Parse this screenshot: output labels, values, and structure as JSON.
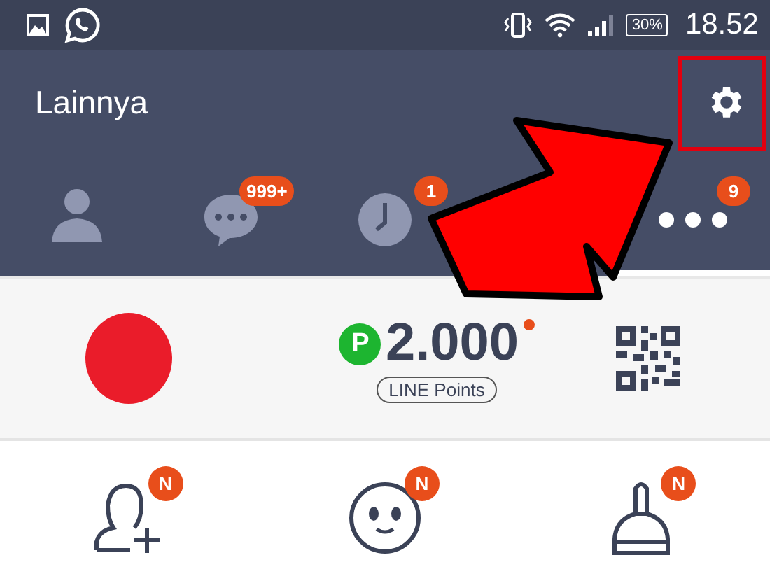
{
  "status_bar": {
    "battery": "30%",
    "time": "18.52"
  },
  "header": {
    "title": "Lainnya"
  },
  "tabs": [
    {
      "kind": "friends",
      "selected": false
    },
    {
      "kind": "chats",
      "badge": "999+",
      "selected": false
    },
    {
      "kind": "timeline",
      "badge": "1",
      "selected": false
    },
    {
      "kind": "more",
      "badge": "9",
      "selected": true
    }
  ],
  "points": {
    "mark": "P",
    "amount": "2.000",
    "new": true,
    "label": "LINE Points"
  },
  "shortcuts": [
    {
      "kind": "add-friend",
      "badge": "N"
    },
    {
      "kind": "sticker",
      "badge": "N"
    },
    {
      "kind": "theme",
      "badge": "N"
    }
  ],
  "annotations": {
    "highlight_frame": true,
    "arrow": true
  }
}
